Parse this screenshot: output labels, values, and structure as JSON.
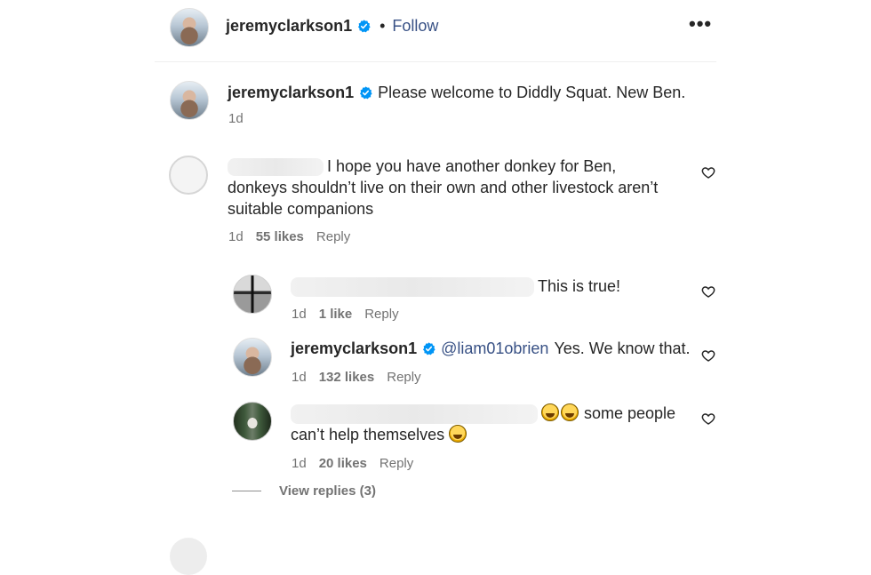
{
  "header": {
    "username": "jeremyclarkson1",
    "separator": "•",
    "follow_label": "Follow",
    "more_label": "•••"
  },
  "caption": {
    "username": "jeremyclarkson1",
    "text": "Please welcome to Diddly Squat. New Ben.",
    "time": "1d"
  },
  "comments": [
    {
      "text": "I hope you have another donkey for Ben, donkeys shouldn’t live on their own and other livestock aren’t suitable companions",
      "line1": "I hope you have another donkey for Ben,",
      "line2": "donkeys shouldn’t live on their own and other livestock aren’t",
      "line3": "suitable companions",
      "time": "1d",
      "likes": "55 likes",
      "reply": "Reply"
    }
  ],
  "replies": [
    {
      "text": "This is true!",
      "time": "1d",
      "likes": "1 like",
      "reply": "Reply"
    },
    {
      "username": "jeremyclarkson1",
      "mention": "@liam01obrien",
      "text": "Yes. We know that.",
      "time": "1d",
      "likes": "132 likes",
      "reply": "Reply"
    },
    {
      "text_line1": "some people",
      "text_line2": "can’t help themselves",
      "time": "1d",
      "likes": "20 likes",
      "reply": "Reply"
    }
  ],
  "view_replies": "View replies (3)",
  "icons": {
    "verified": "verified-badge-icon",
    "heart": "heart-outline-icon",
    "more": "more-options-icon"
  },
  "colors": {
    "link_blue": "#385185",
    "verified_blue": "#0095f6",
    "muted_text": "#737373"
  }
}
